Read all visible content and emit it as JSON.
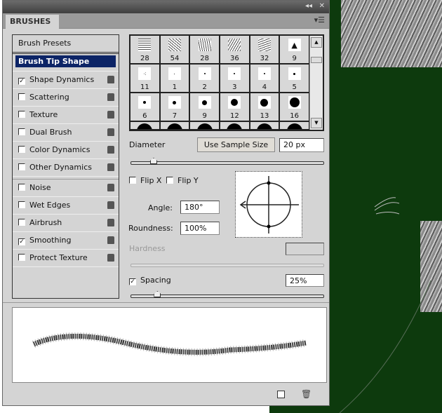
{
  "panel": {
    "title": "BRUSHES",
    "collapse_icon": "double-chevron-left",
    "close_icon": "close",
    "menu_icon": "panel-menu"
  },
  "sidebar": {
    "presets_label": "Brush Presets",
    "items": [
      {
        "label": "Brush Tip Shape",
        "checked": null,
        "selected": true
      },
      {
        "label": "Shape Dynamics",
        "checked": true
      },
      {
        "label": "Scattering",
        "checked": false
      },
      {
        "label": "Texture",
        "checked": false
      },
      {
        "label": "Dual Brush",
        "checked": false
      },
      {
        "label": "Color Dynamics",
        "checked": false
      },
      {
        "label": "Other Dynamics",
        "checked": false
      },
      {
        "label": "Noise",
        "checked": false
      },
      {
        "label": "Wet Edges",
        "checked": false
      },
      {
        "label": "Airbrush",
        "checked": false
      },
      {
        "label": "Smoothing",
        "checked": true
      },
      {
        "label": "Protect Texture",
        "checked": false
      }
    ]
  },
  "brush_grid": {
    "sizes": [
      "28",
      "54",
      "28",
      "36",
      "32",
      "9",
      "11",
      "1",
      "2",
      "3",
      "4",
      "5",
      "6",
      "7",
      "9",
      "12",
      "13",
      "16"
    ]
  },
  "controls": {
    "diameter_label": "Diameter",
    "use_sample_size": "Use Sample Size",
    "diameter_value": "20 px",
    "diameter_fraction": 0.1,
    "flip_x": "Flip X",
    "flip_y": "Flip Y",
    "flip_x_checked": false,
    "flip_y_checked": false,
    "angle_label": "Angle:",
    "angle_value": "180°",
    "roundness_label": "Roundness:",
    "roundness_value": "100%",
    "hardness_label": "Hardness",
    "hardness_value": "",
    "spacing_label": "Spacing",
    "spacing_checked": true,
    "spacing_value": "25%",
    "spacing_fraction": 0.12
  },
  "footer": {
    "new_icon": "new-preset",
    "delete_icon": "trash"
  }
}
